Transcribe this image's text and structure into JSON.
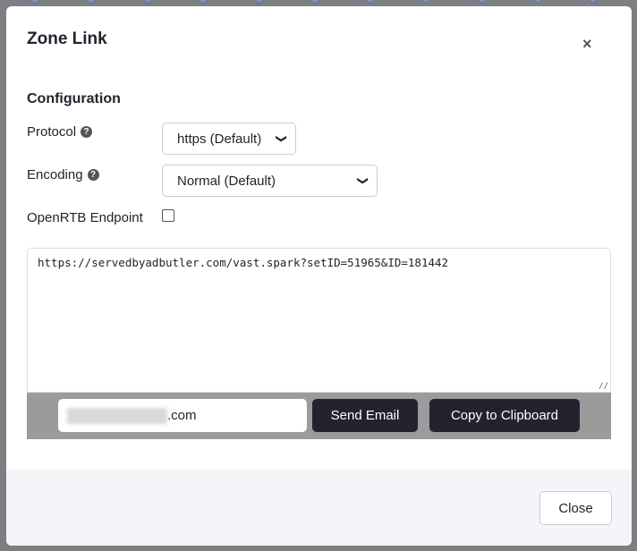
{
  "dialog": {
    "title": "Zone Link",
    "close_icon": "×",
    "section": "Configuration",
    "protocol": {
      "label": "Protocol",
      "value": "https (Default)"
    },
    "encoding": {
      "label": "Encoding",
      "value": "Normal (Default)"
    },
    "openrtb": {
      "label": "OpenRTB Endpoint",
      "checked": false
    },
    "link": "https://servedbyadbutler.com/vast.spark?setID=51965&ID=181442",
    "email_suffix": ".com",
    "send_email": "Send Email",
    "copy": "Copy to Clipboard",
    "close": "Close"
  }
}
